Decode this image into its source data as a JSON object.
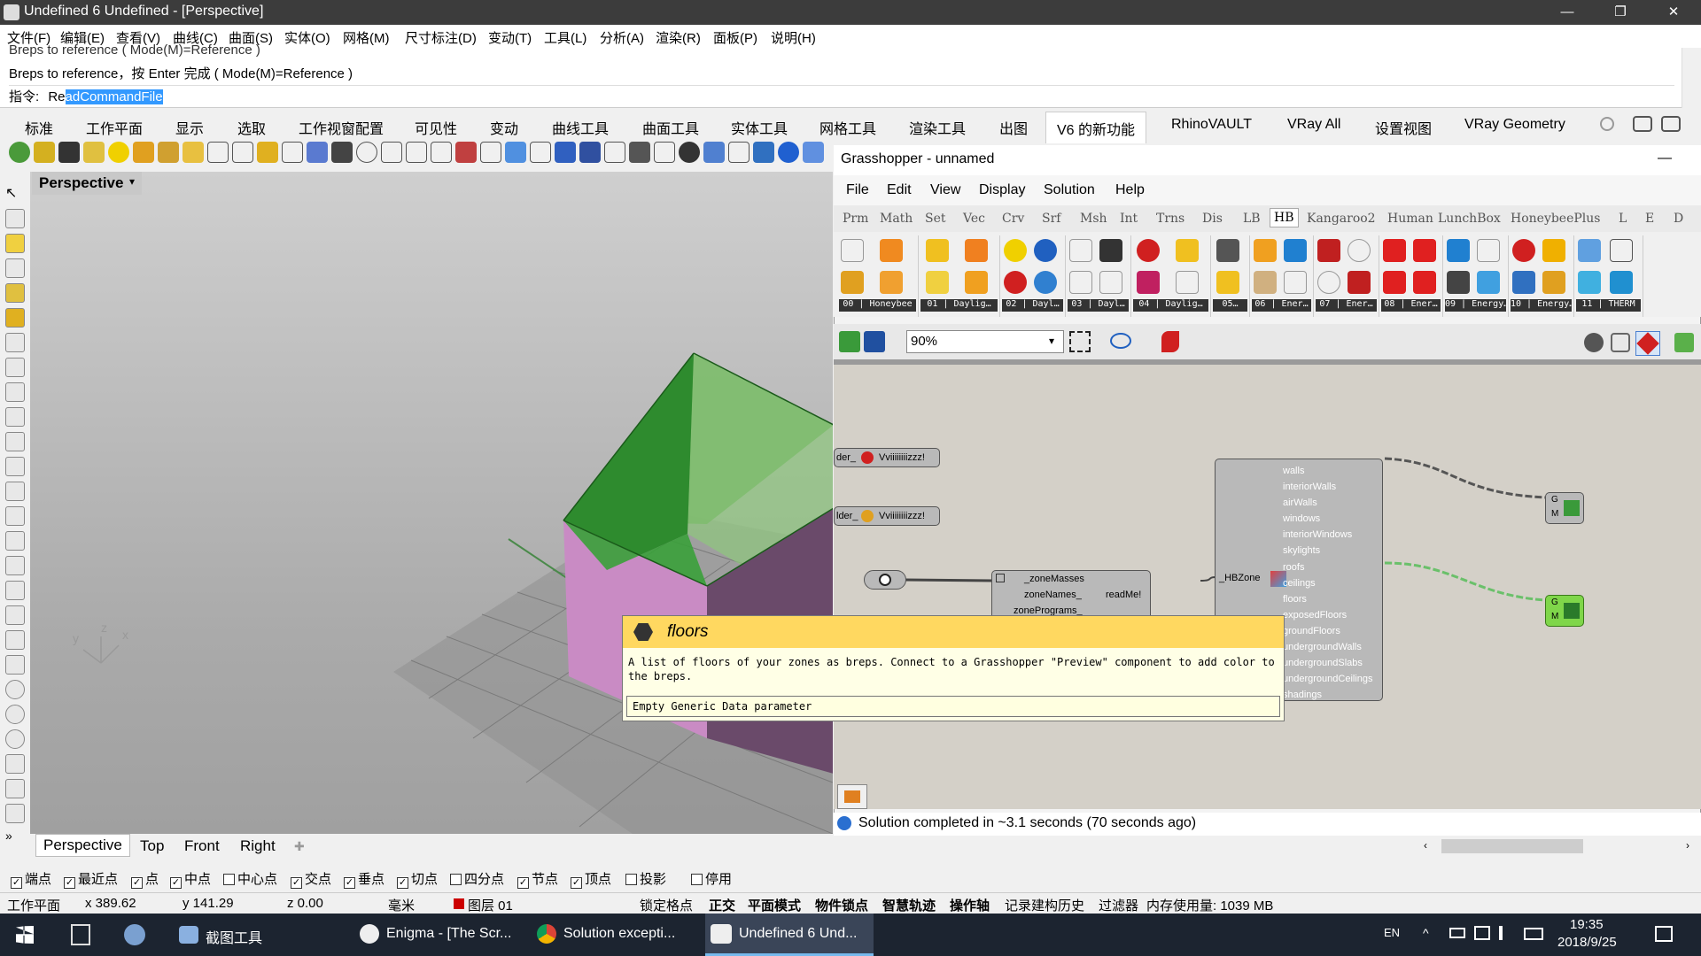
{
  "app": {
    "title": "Undefined 6 Undefined - [Perspective]",
    "minimize": "—",
    "maximize": "❐",
    "close": "✕"
  },
  "menu": [
    "文件(F)",
    "编辑(E)",
    "查看(V)",
    "曲线(C)",
    "曲面(S)",
    "实体(O)",
    "网格(M)",
    "尺寸标注(D)",
    "变动(T)",
    "工具(L)",
    "分析(A)",
    "渲染(R)",
    "面板(P)",
    "说明(H)"
  ],
  "command": {
    "history_line1": "Breps to reference ( Mode(M)=Reference )",
    "history_line2": "Breps to reference，按 Enter 完成 ( Mode(M)=Reference )",
    "prompt_label": "指令:",
    "input_prefix": "Re",
    "input_selected": "adCommandFile"
  },
  "rhino_tabs": [
    "标准",
    "工作平面",
    "显示",
    "选取",
    "工作视窗配置",
    "可见性",
    "变动",
    "曲线工具",
    "曲面工具",
    "实体工具",
    "网格工具",
    "渲染工具",
    "出图",
    "V6 的新功能",
    "RhinoVAULT",
    "VRay All",
    "设置视图",
    "VRay Geometry"
  ],
  "viewport": {
    "name": "Perspective",
    "dropdown_icon": "▾",
    "axis_x": "x",
    "axis_y": "y",
    "axis_z": "z"
  },
  "viewport_tabs": [
    "Perspective",
    "Top",
    "Front",
    "Right"
  ],
  "viewport_tab_add": "✚",
  "osnaps": [
    {
      "label": "端点",
      "checked": true
    },
    {
      "label": "最近点",
      "checked": true
    },
    {
      "label": "点",
      "checked": true
    },
    {
      "label": "中点",
      "checked": true
    },
    {
      "label": "中心点",
      "checked": false
    },
    {
      "label": "交点",
      "checked": true
    },
    {
      "label": "垂点",
      "checked": true
    },
    {
      "label": "切点",
      "checked": true
    },
    {
      "label": "四分点",
      "checked": false
    },
    {
      "label": "节点",
      "checked": true
    },
    {
      "label": "顶点",
      "checked": true
    },
    {
      "label": "投影",
      "checked": false
    },
    {
      "label": "停用",
      "checked": false
    }
  ],
  "status": {
    "cplane": "工作平面",
    "x": "x 389.62",
    "y": "y 141.29",
    "z": "z 0.00",
    "units": "毫米",
    "layer": "图层 01",
    "grid_snap": "锁定格点",
    "ortho": "正交",
    "planar": "平面模式",
    "osnap": "物件锁点",
    "smarttrack": "智慧轨迹",
    "gumball": "操作轴",
    "history": "记录建构历史",
    "filter": "过滤器",
    "memory": "内存使用量: 1039 MB",
    "layer_color": "#cc0000"
  },
  "grasshopper": {
    "title": "Grasshopper - unnamed",
    "minimize": "—",
    "menu": [
      "File",
      "Edit",
      "View",
      "Display",
      "Solution",
      "Help"
    ],
    "tabs": [
      "Prm",
      "Math",
      "Set",
      "Vec",
      "Crv",
      "Srf",
      "Msh",
      "Int",
      "Trns",
      "Dis",
      "LB",
      "HB",
      "Kangaroo2",
      "Human",
      "LunchBox",
      "HoneybeePlus",
      "L",
      "E",
      "D"
    ],
    "active_tab": "HB",
    "group_labels": [
      "00 | Honeybee",
      "01 | Daylig…",
      "02 | Dayl…",
      "03 | Dayl…",
      "04 | Daylig…",
      "05…",
      "06 | Ener…",
      "07 | Ener…",
      "08 | Ener…",
      "09 | Energy…",
      "10 | Energy…",
      "11 | THERM"
    ],
    "zoom": "90%",
    "status": "Solution completed in ~3.1 seconds (70 seconds ago)",
    "canvas": {
      "node1_in": "der_",
      "node1_label": "Vviiiiiiiizzz!",
      "node2_in": "lder_",
      "node2_label": "Vviiiiiiiizzz!",
      "reader_inputs": [
        "_zoneMasses",
        "zoneNames_",
        "zonePrograms_"
      ],
      "reader_output": "readMe!",
      "decomp_input": "_HBZone",
      "decomp_outputs": [
        "walls",
        "interiorWalls",
        "airWalls",
        "windows",
        "interiorWindows",
        "skylights",
        "roofs",
        "ceilings",
        "floors",
        "exposedFloors",
        "groundFloors",
        "undergroundWalls",
        "undergroundSlabs",
        "undergroundCeilings",
        "shadings"
      ],
      "preview_g": "G",
      "preview_m": "M"
    }
  },
  "tooltip": {
    "title": "floors",
    "description": "A list of floors of your zones as breps.  Connect to a Grasshopper \"Preview\" component to add color to the breps.",
    "data": "Empty Generic Data parameter"
  },
  "taskbar": {
    "items": [
      "截图工具",
      "Enigma - [The Scr...",
      "Solution excepti...",
      "Undefined 6 Und..."
    ],
    "lang": "EN",
    "time": "19:35",
    "date": "2018/9/25"
  },
  "colors": {
    "accent": "#3399ff",
    "brep_green": "#2e8b2e",
    "brep_pink": "#c98bc4",
    "tooltip_header": "#ffd860",
    "preview_selected": "#7fd64a"
  }
}
